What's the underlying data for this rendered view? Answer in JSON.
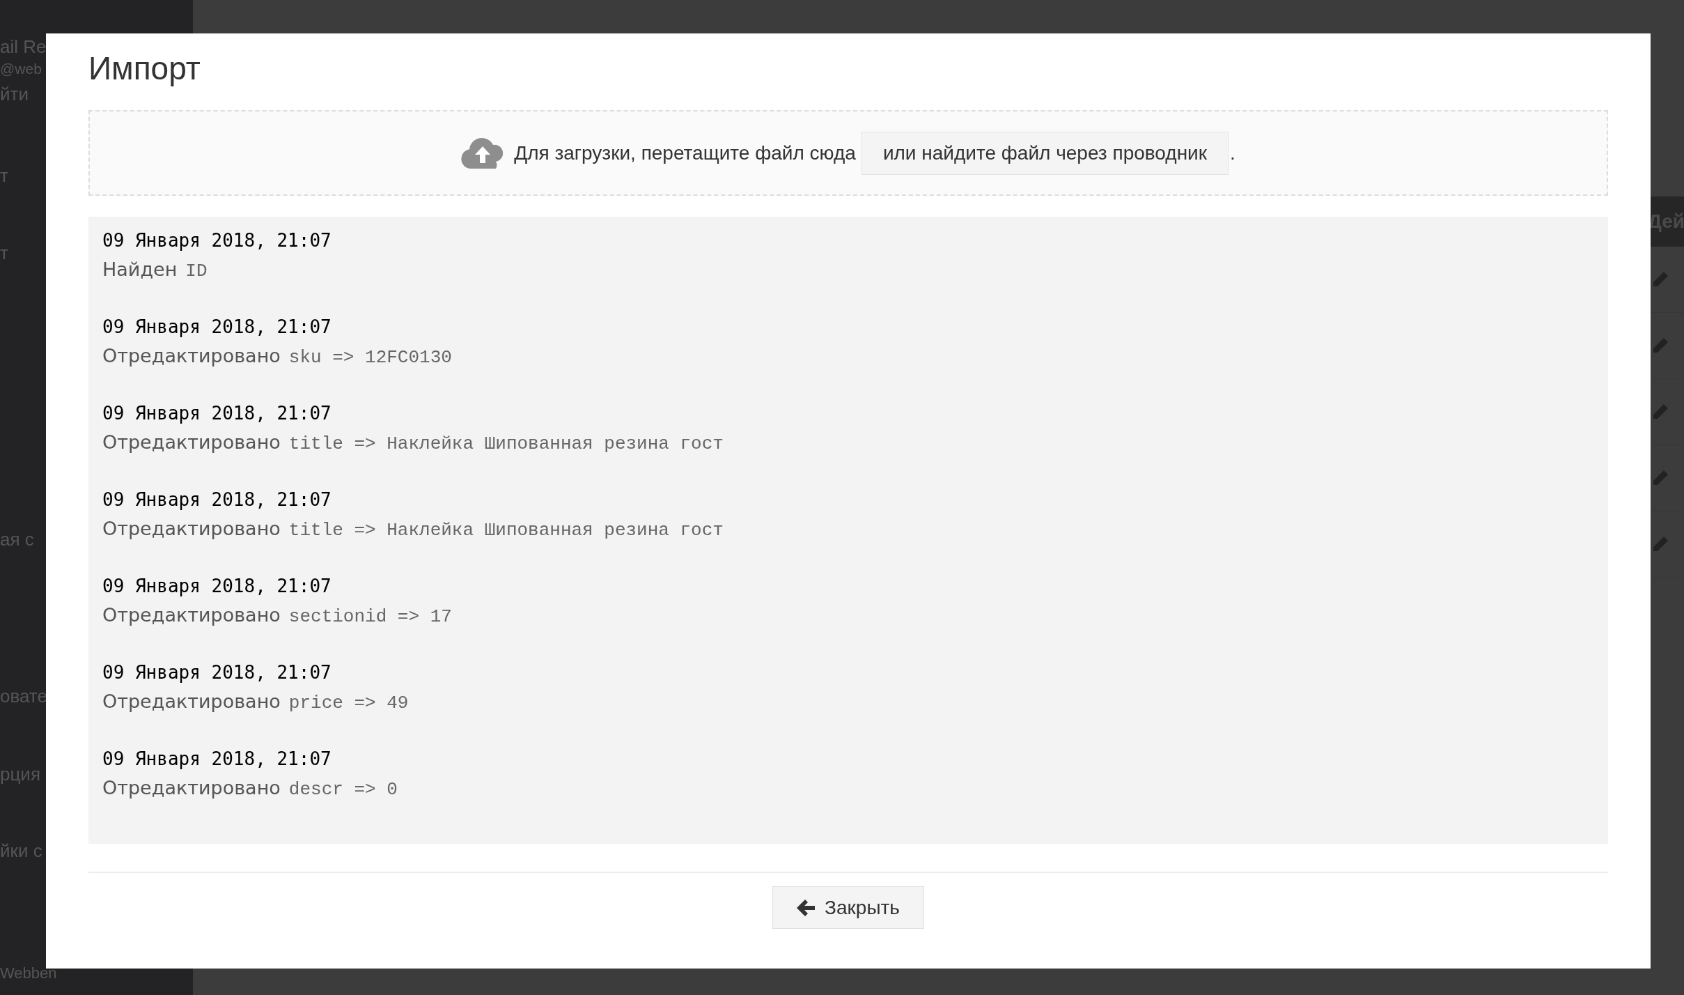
{
  "sidebar": {
    "items": [
      {
        "label": "ail Re"
      },
      {
        "label": "@web"
      },
      {
        "label": "йти"
      },
      {
        "label": "т"
      },
      {
        "label": "т"
      },
      {
        "label": "ая с"
      },
      {
        "label": "овате"
      },
      {
        "label": "рция"
      },
      {
        "label": "йки с"
      }
    ],
    "footer": "Webben"
  },
  "background_table": {
    "header": "Дей",
    "rows": [
      {
        "kind": "edit"
      },
      {
        "kind": "edit"
      },
      {
        "kind": "edit"
      },
      {
        "kind": "edit"
      },
      {
        "kind": "edit"
      }
    ]
  },
  "dialog": {
    "title": "Импорт",
    "dropzone": {
      "text": "Для загрузки, перетащите файл сюда",
      "button": "или найдите файл через проводник",
      "trailing": "."
    },
    "log": [
      {
        "date": "09 Января 2018, 21:07",
        "label": "Найден",
        "value": "ID"
      },
      {
        "date": "09 Января 2018, 21:07",
        "label": "Отредактировано",
        "value": "sku => 12FC0130"
      },
      {
        "date": "09 Января 2018, 21:07",
        "label": "Отредактировано",
        "value": "title => Наклейка Шипованная резина гост"
      },
      {
        "date": "09 Января 2018, 21:07",
        "label": "Отредактировано",
        "value": "title => Наклейка Шипованная резина гост"
      },
      {
        "date": "09 Января 2018, 21:07",
        "label": "Отредактировано",
        "value": "sectionid => 17"
      },
      {
        "date": "09 Января 2018, 21:07",
        "label": "Отредактировано",
        "value": "price => 49"
      },
      {
        "date": "09 Января 2018, 21:07",
        "label": "Отредактировано",
        "value": "descr => 0"
      }
    ],
    "close_button": "Закрыть"
  }
}
